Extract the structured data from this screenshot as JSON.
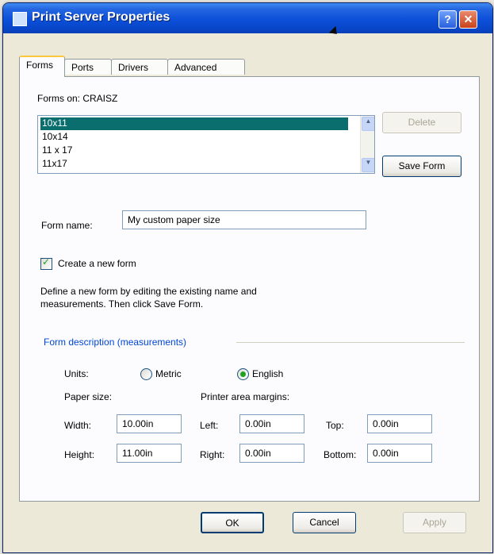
{
  "window": {
    "title": "Print Server Properties",
    "help_glyph": "?",
    "close_glyph": "✕"
  },
  "tabs": [
    {
      "label": "Forms",
      "active": true
    },
    {
      "label": "Ports",
      "active": false
    },
    {
      "label": "Drivers",
      "active": false
    },
    {
      "label": "Advanced",
      "active": false
    }
  ],
  "forms": {
    "forms_on_label": "Forms on: CRAISZ",
    "list": [
      "10x11",
      "10x14",
      "11 x 17",
      "11x17"
    ],
    "selected_index": 0,
    "delete_label": "Delete",
    "save_form_label": "Save Form",
    "form_name_label": "Form name:",
    "form_name_value": "My custom paper size",
    "create_new_label": "Create a new form",
    "create_new_checked": true,
    "description_line1": "Define a new form by editing the existing name and",
    "description_line2": "measurements.  Then click Save Form.",
    "group_title": "Form description (measurements)",
    "units_label": "Units:",
    "metric_label": "Metric",
    "english_label": "English",
    "units_selected": "English",
    "paper_size_label": "Paper size:",
    "margins_label": "Printer area margins:",
    "width_label": "Width:",
    "width_value": "10.00in",
    "height_label": "Height:",
    "height_value": "11.00in",
    "left_label": "Left:",
    "left_value": "0.00in",
    "right_label": "Right:",
    "right_value": "0.00in",
    "top_label": "Top:",
    "top_value": "0.00in",
    "bottom_label": "Bottom:",
    "bottom_value": "0.00in"
  },
  "footer": {
    "ok_label": "OK",
    "cancel_label": "Cancel",
    "apply_label": "Apply"
  }
}
